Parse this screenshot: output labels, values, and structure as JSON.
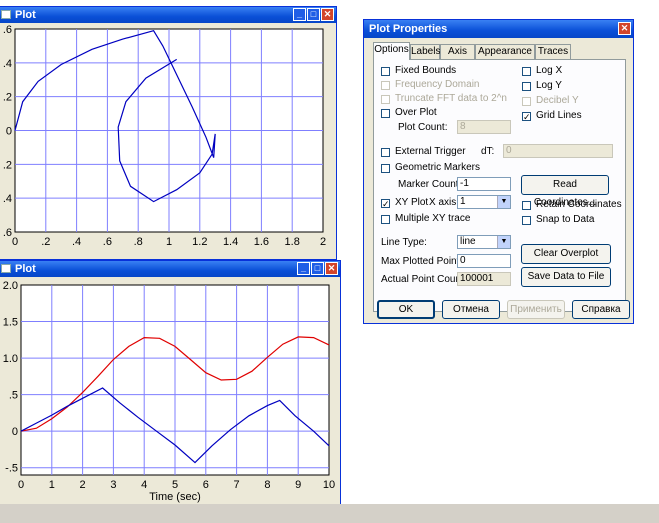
{
  "plot1": {
    "title": "Plot",
    "yticks": [
      ".6",
      ".4",
      ".2",
      "0",
      ".2",
      ".4",
      ".6"
    ],
    "xticks": [
      "0",
      ".2",
      ".4",
      ".6",
      ".8",
      "1",
      "1.2",
      "1.4",
      "1.6",
      "1.8",
      "2"
    ]
  },
  "plot2": {
    "title": "Plot",
    "yticks": [
      "2.0",
      "1.5",
      "1.0",
      ".5",
      "0",
      "-.5"
    ],
    "xticks": [
      "0",
      "1",
      "2",
      "3",
      "4",
      "5",
      "6",
      "7",
      "8",
      "9",
      "10"
    ],
    "xlabel": "Time (sec)"
  },
  "chart_data": [
    {
      "type": "line",
      "title": "Plot",
      "xlim": [
        0,
        2
      ],
      "ylim": [
        -0.6,
        0.6
      ],
      "grid": true,
      "series": [
        {
          "color": "#0000c0",
          "x": [
            0,
            0.05,
            0.15,
            0.3,
            0.5,
            0.7,
            0.9,
            0.96,
            1.05,
            1.15,
            1.24,
            1.29,
            1.3,
            1.28,
            1.2,
            1.05,
            0.9,
            0.75,
            0.68,
            0.67,
            0.72,
            0.85,
            1.05
          ],
          "y": [
            0,
            0.17,
            0.29,
            0.39,
            0.48,
            0.54,
            0.59,
            0.5,
            0.33,
            0.14,
            -0.04,
            -0.16,
            -0.02,
            -0.14,
            -0.25,
            -0.35,
            -0.42,
            -0.33,
            -0.18,
            0.02,
            0.17,
            0.31,
            0.42
          ]
        }
      ]
    },
    {
      "type": "line",
      "xlabel": "Time (sec)",
      "xlim": [
        0,
        10
      ],
      "ylim": [
        -0.6,
        2.0
      ],
      "grid": true,
      "series": [
        {
          "color": "#e00000",
          "x": [
            0,
            0.5,
            1,
            1.5,
            2,
            2.5,
            3,
            3.5,
            4,
            4.5,
            5,
            5.5,
            6,
            6.5,
            7,
            7.5,
            8,
            8.5,
            9,
            9.5,
            10
          ],
          "y": [
            0,
            0.04,
            0.17,
            0.33,
            0.53,
            0.75,
            0.98,
            1.16,
            1.28,
            1.27,
            1.16,
            0.98,
            0.8,
            0.7,
            0.71,
            0.82,
            1.01,
            1.19,
            1.29,
            1.28,
            1.18
          ]
        },
        {
          "color": "#0000c0",
          "x": [
            0,
            0.5,
            1,
            1.5,
            2,
            2.65,
            3.2,
            3.8,
            4.4,
            5,
            5.65,
            6.2,
            6.8,
            7.4,
            8.0,
            8.4,
            8.9,
            9.5,
            10
          ],
          "y": [
            0,
            0.11,
            0.22,
            0.34,
            0.45,
            0.59,
            0.39,
            0.19,
            0.0,
            -0.19,
            -0.43,
            -0.2,
            0.02,
            0.21,
            0.35,
            0.42,
            0.21,
            0.0,
            -0.2
          ]
        }
      ]
    }
  ],
  "dialog": {
    "title": "Plot Properties",
    "tabs": [
      "Options",
      "Labels",
      "Axis",
      "Appearance",
      "Traces"
    ],
    "options": {
      "fixed_bounds": "Fixed Bounds",
      "frequency_domain": "Frequency Domain",
      "truncate_fft": "Truncate FFT data to 2^n",
      "over_plot": "Over Plot",
      "plot_count_label": "Plot Count:",
      "plot_count_value": "8",
      "log_x": "Log X",
      "log_y": "Log Y",
      "decibel_y": "Decibel Y",
      "grid_lines": "Grid Lines",
      "external_trigger": "External Trigger",
      "dt_label": "dT:",
      "dt_value": "0",
      "geometric_markers": "Geometric Markers",
      "marker_count_label": "Marker Count:",
      "marker_count_value": "-1",
      "xy_plot": "XY Plot",
      "x_axis_label": "X axis:",
      "x_axis_value": "1",
      "multiple_xy": "Multiple XY trace",
      "read_coordinates": "Read Coordinates...",
      "retain_coordinates": "Retain Coordinates",
      "snap_to_data": "Snap to Data",
      "line_type_label": "Line Type:",
      "line_type_value": "line",
      "max_points_label": "Max Plotted Points:",
      "max_points_value": "0",
      "actual_count_label": "Actual Point Count:",
      "actual_count_value": "100001",
      "clear_overplot": "Clear Overplot",
      "save_data": "Save Data to File"
    },
    "buttons": {
      "ok": "OK",
      "cancel": "Отмена",
      "apply": "Применить",
      "help": "Справка"
    }
  }
}
